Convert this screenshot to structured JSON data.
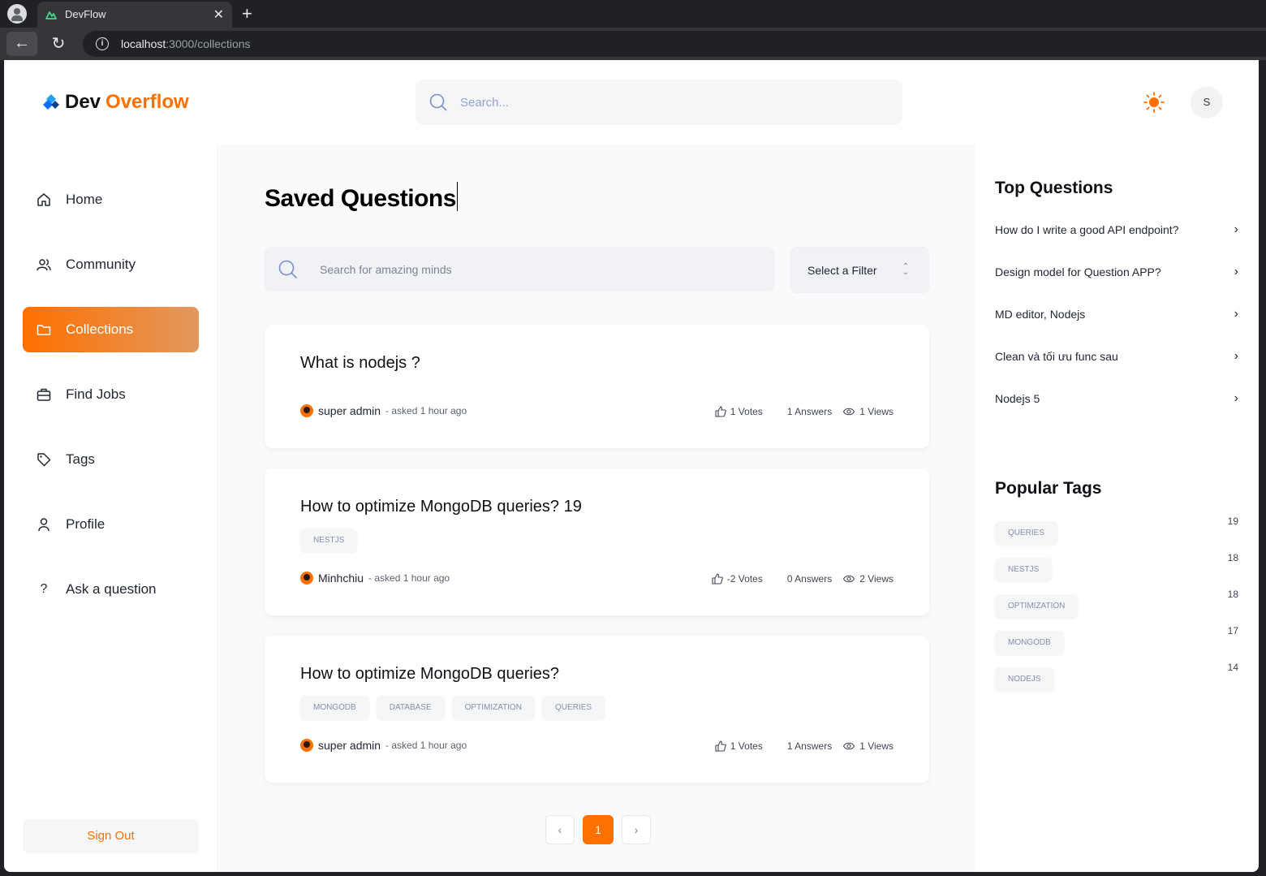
{
  "browser": {
    "tab_title": "DevFlow",
    "url_host": "localhost",
    "url_path": ":3000/collections"
  },
  "header": {
    "logo_dev": "Dev",
    "logo_overflow": "Overflow",
    "search_placeholder": "Search...",
    "avatar_initial": "S"
  },
  "sidebar": {
    "items": [
      {
        "label": "Home",
        "icon": "home-icon"
      },
      {
        "label": "Community",
        "icon": "users-icon"
      },
      {
        "label": "Collections",
        "icon": "folder-icon",
        "active": true
      },
      {
        "label": "Find Jobs",
        "icon": "briefcase-icon"
      },
      {
        "label": "Tags",
        "icon": "tag-icon"
      },
      {
        "label": "Profile",
        "icon": "user-icon"
      },
      {
        "label": "Ask a question",
        "icon": "question-icon"
      }
    ],
    "signout": "Sign Out"
  },
  "main": {
    "title": "Saved Questions",
    "search_placeholder": "Search for amazing minds",
    "filter_label": "Select a Filter",
    "questions": [
      {
        "title": "What is nodejs ?",
        "tags": [],
        "author": "super admin",
        "meta": "- asked 1 hour ago",
        "votes": "1 Votes",
        "answers": "1 Answers",
        "views": "1 Views"
      },
      {
        "title": "How to optimize MongoDB queries? 19",
        "tags": [
          "NESTJS"
        ],
        "author": "Minhchiu",
        "meta": "- asked 1 hour ago",
        "votes": "-2 Votes",
        "answers": "0 Answers",
        "views": "2 Views"
      },
      {
        "title": "How to optimize MongoDB queries?",
        "tags": [
          "MONGODB",
          "DATABASE",
          "OPTIMIZATION",
          "QUERIES"
        ],
        "author": "super admin",
        "meta": "- asked 1 hour ago",
        "votes": "1 Votes",
        "answers": "1 Answers",
        "views": "1 Views"
      }
    ],
    "pagination": {
      "current": "1",
      "prev": "‹",
      "next": "›"
    }
  },
  "rightbar": {
    "top_questions_heading": "Top Questions",
    "top_questions": [
      "How do I write a good API endpoint?",
      "Design model for Question APP?",
      "MD editor, Nodejs",
      "Clean và tối ưu func sau",
      "Nodejs 5"
    ],
    "popular_tags_heading": "Popular Tags",
    "popular_tags": [
      {
        "name": "QUERIES",
        "count": "19"
      },
      {
        "name": "NESTJS",
        "count": "18"
      },
      {
        "name": "OPTIMIZATION",
        "count": "18"
      },
      {
        "name": "MONGODB",
        "count": "17"
      },
      {
        "name": "NODEJS",
        "count": "14"
      }
    ]
  },
  "colors": {
    "accent": "#ff7000",
    "accent_gradient_end": "#e2985e"
  }
}
